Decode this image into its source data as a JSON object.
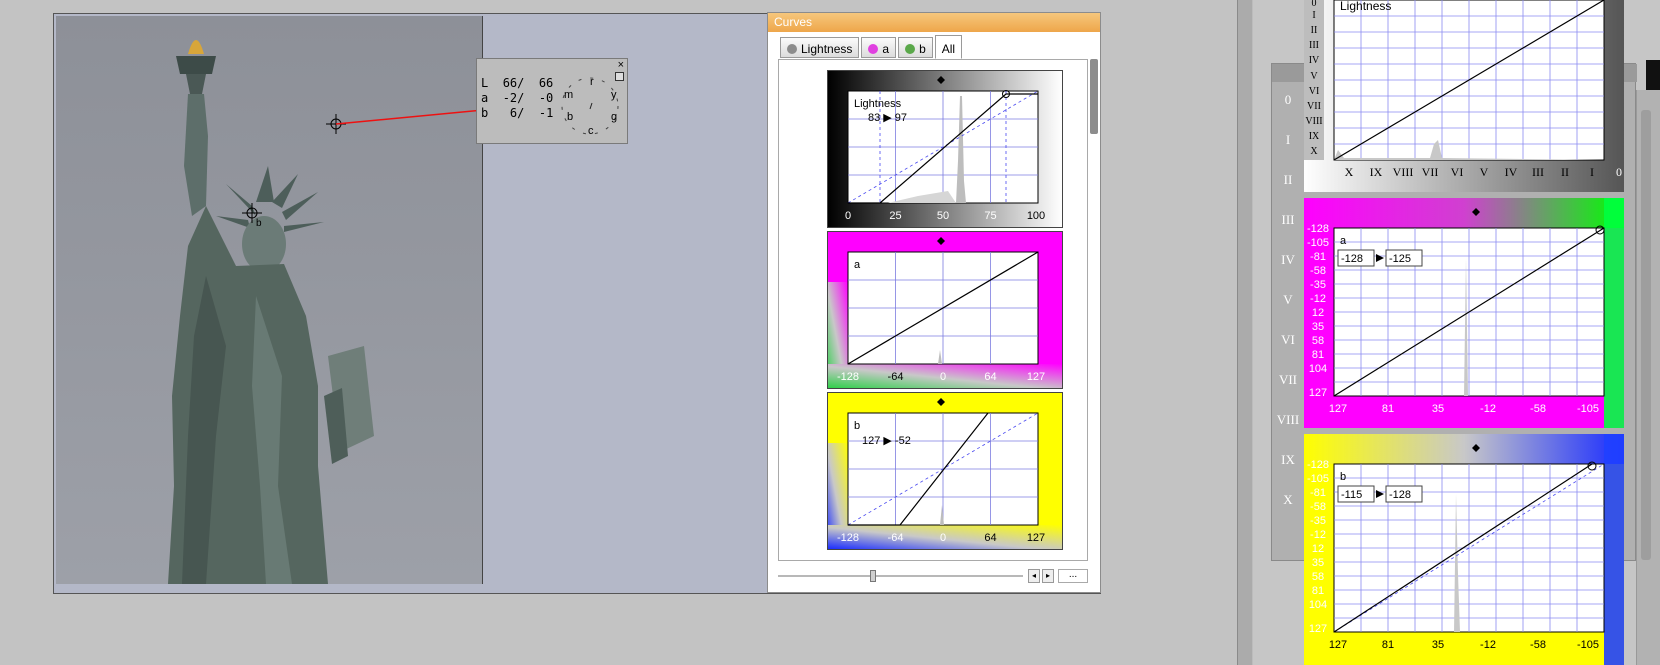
{
  "picker": {
    "close": "×",
    "rows": [
      {
        "ch": "L",
        "in": "66",
        "out": "66"
      },
      {
        "ch": "a",
        "in": "-2",
        "out": "-0"
      },
      {
        "ch": "b",
        "in": "6",
        "out": "-1"
      }
    ],
    "dial_labels": [
      "m",
      "r",
      "y",
      "b",
      "c",
      "g"
    ]
  },
  "sample_point_label": "b",
  "curves": {
    "title": "Curves",
    "tabs": [
      {
        "label": "Lightness",
        "color": "#8c8c8c",
        "active": false
      },
      {
        "label": "a",
        "color": "#e040e0",
        "active": false
      },
      {
        "label": "b",
        "color": "#5aa84a",
        "active": false
      },
      {
        "label": "All",
        "color": "",
        "active": true
      }
    ],
    "more": "...",
    "lightness": {
      "name": "Lightness",
      "mapping": "83 ▶ 97",
      "ticks": [
        "0",
        "25",
        "50",
        "75",
        "100"
      ],
      "curve_points": [
        [
          0,
          0
        ],
        [
          17,
          0
        ],
        [
          83,
          97
        ],
        [
          100,
          97
        ]
      ]
    },
    "a": {
      "name": "a",
      "ticks": [
        "-128",
        "-64",
        "0",
        "64",
        "127"
      ],
      "curve_points": [
        [
          -128,
          -128
        ],
        [
          127,
          127
        ]
      ]
    },
    "b": {
      "name": "b",
      "mapping": "127 ▶ -52",
      "ticks": [
        "-128",
        "-64",
        "0",
        "64",
        "127"
      ],
      "curve_points": [
        [
          -128,
          -128
        ],
        [
          -70,
          -128
        ],
        [
          50,
          127
        ]
      ]
    }
  },
  "right": {
    "zones": [
      "0",
      "I",
      "II",
      "III",
      "IV",
      "V",
      "VI",
      "VII",
      "VIII",
      "IX",
      "X"
    ],
    "top_zones": [
      "0",
      "I",
      "II",
      "III",
      "IV",
      "V",
      "VI",
      "VII",
      "VIII",
      "IX",
      "X"
    ],
    "lightness": {
      "name": "Lightness",
      "ticks": [
        "X",
        "IX",
        "VIII",
        "VII",
        "VI",
        "V",
        "IV",
        "III",
        "II",
        "I",
        "0"
      ]
    },
    "a": {
      "name": "a",
      "mapping_in": "-128",
      "mapping_out": "-125",
      "yticks": [
        "-128",
        "-105",
        "-81",
        "-58",
        "-35",
        "-12",
        "12",
        "35",
        "58",
        "81",
        "104",
        "127"
      ],
      "xticks": [
        "127",
        "81",
        "35",
        "-12",
        "-58",
        "-105"
      ]
    },
    "b": {
      "name": "b",
      "mapping_in": "-115",
      "mapping_out": "-128",
      "yticks": [
        "-128",
        "-105",
        "-81",
        "-58",
        "-35",
        "-12",
        "12",
        "35",
        "58",
        "81",
        "104",
        "127"
      ],
      "xticks": [
        "127",
        "81",
        "35",
        "-12",
        "-58",
        "-105"
      ]
    }
  }
}
